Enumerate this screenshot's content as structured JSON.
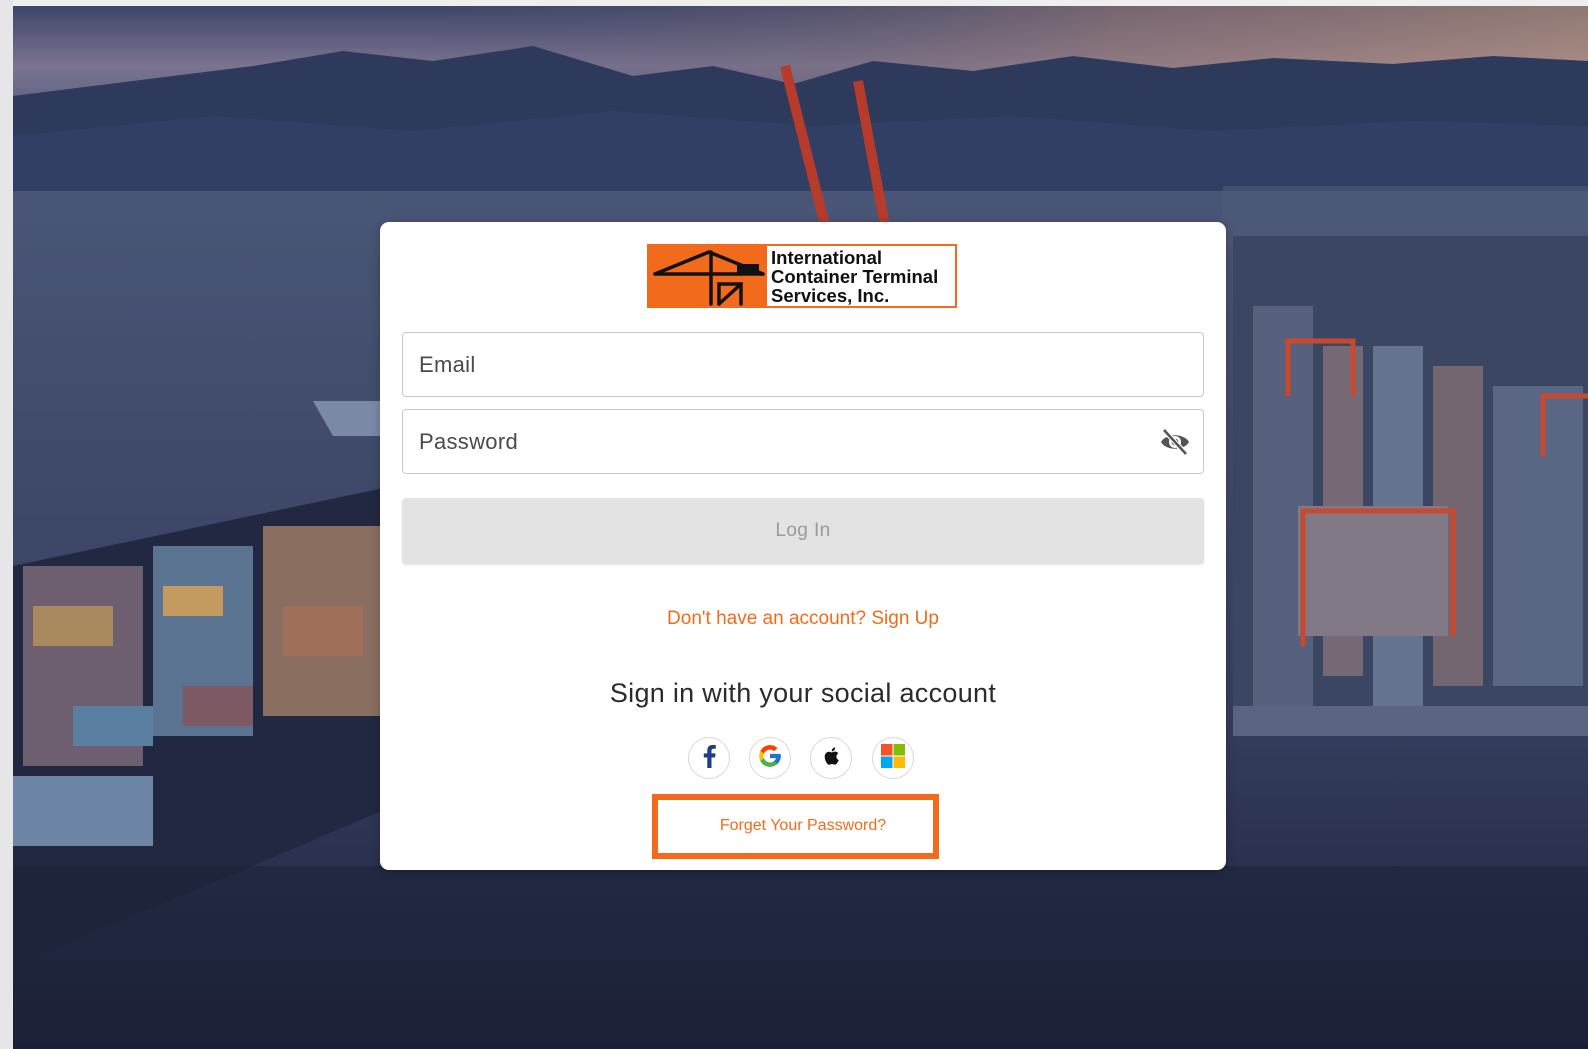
{
  "logo": {
    "text": "International\nContainer Terminal\nServices, Inc.",
    "brand_color": "#f26a1b"
  },
  "form": {
    "email_placeholder": "Email",
    "password_placeholder": "Password",
    "password_toggle_icon": "eye-off-icon",
    "login_label": "Log In",
    "signup_text": "Don't have an account? Sign Up"
  },
  "social": {
    "heading": "Sign in with your social account",
    "providers": [
      "facebook-icon",
      "google-icon",
      "apple-icon",
      "microsoft-icon"
    ]
  },
  "forgot": {
    "label": "Forget Your Password?",
    "highlight_color": "#f26a1b"
  }
}
